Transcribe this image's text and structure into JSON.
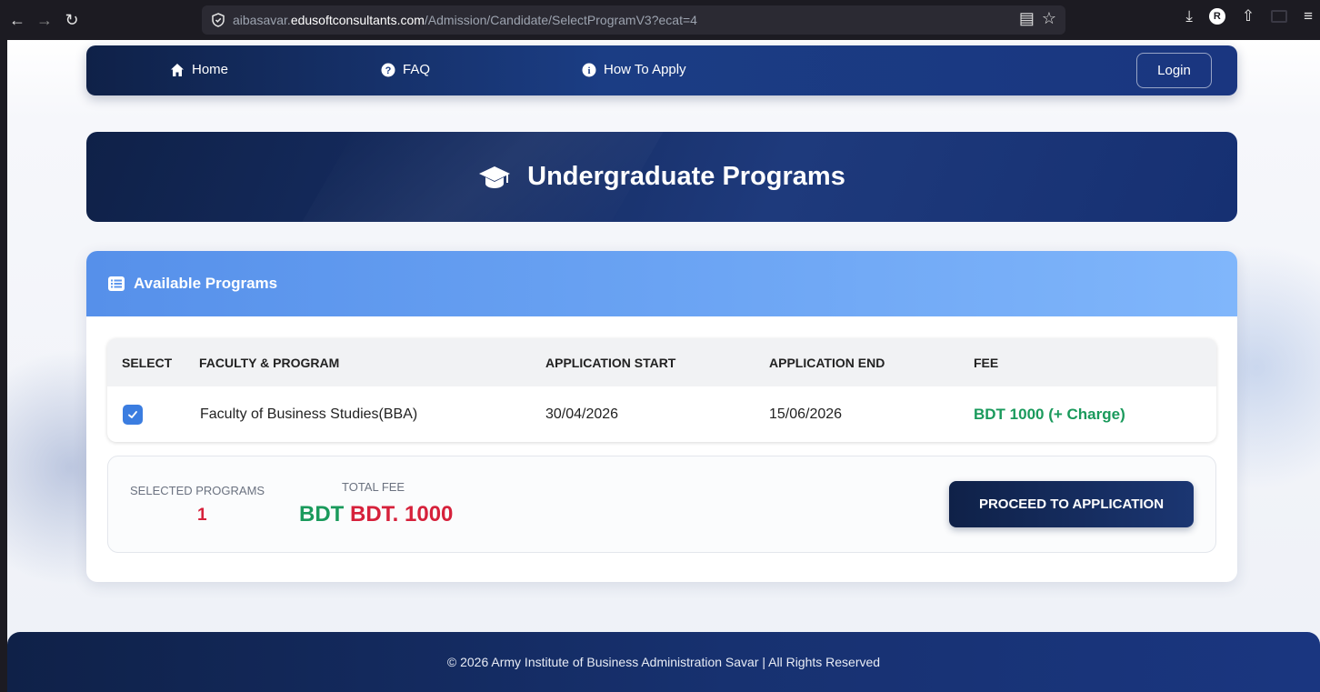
{
  "browser": {
    "url_prefix": "aibasavar.",
    "url_domain": "edusoftconsultants.com",
    "url_path": "/Admission/Candidate/SelectProgramV3?ecat=4",
    "back_icon": "arrow-left-icon",
    "forward_icon": "arrow-right-icon",
    "reload_icon": "reload-icon"
  },
  "nav": {
    "home": "Home",
    "faq": "FAQ",
    "how_to_apply": "How To Apply",
    "login": "Login"
  },
  "hero": {
    "title": "Undergraduate Programs",
    "icon": "graduation-cap-icon"
  },
  "programs": {
    "header": "Available Programs",
    "columns": {
      "select": "SELECT",
      "faculty": "FACULTY & PROGRAM",
      "start": "APPLICATION START",
      "end": "APPLICATION END",
      "fee": "FEE"
    },
    "rows": [
      {
        "checked": true,
        "program": "Faculty of Business Studies(BBA)",
        "start": "30/04/2026",
        "end": "15/06/2026",
        "fee": "BDT 1000 (+ Charge)"
      }
    ]
  },
  "summary": {
    "selected_label": "SELECTED PROGRAMS",
    "selected_count": "1",
    "total_label": "TOTAL FEE",
    "total_currency": "BDT",
    "total_amount": "BDT. 1000",
    "proceed": "PROCEED TO APPLICATION"
  },
  "footer": {
    "text": "© 2026 Army Institute of Business Administration Savar | All Rights Reserved"
  },
  "colors": {
    "navy": "#0f2148",
    "accent_blue": "#5690ea",
    "fee_green": "#1a9a5c",
    "total_red": "#d6213b"
  }
}
